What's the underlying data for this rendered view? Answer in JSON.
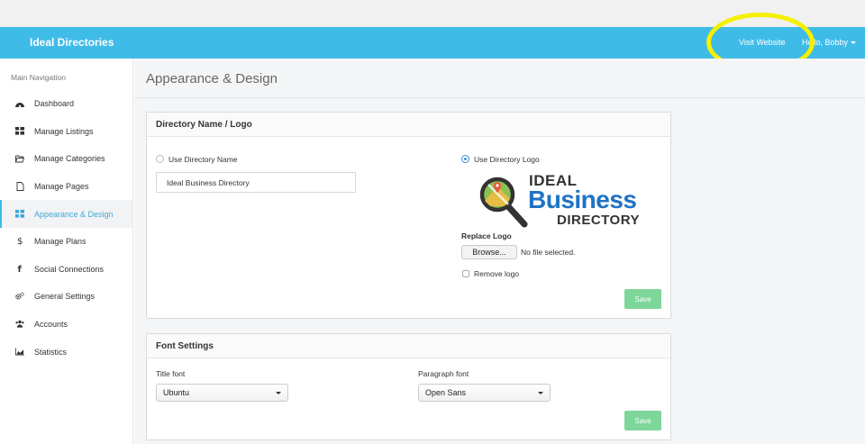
{
  "navbar": {
    "brand": "Ideal Directories",
    "visit_website": "Visit Website",
    "user_greeting": "Hello, Bobby"
  },
  "sidebar": {
    "heading": "Main Navigation",
    "items": [
      {
        "label": "Dashboard",
        "icon": "dashboard-icon"
      },
      {
        "label": "Manage Listings",
        "icon": "th-large-icon"
      },
      {
        "label": "Manage Categories",
        "icon": "folder-open-icon"
      },
      {
        "label": "Manage Pages",
        "icon": "file-icon"
      },
      {
        "label": "Appearance & Design",
        "icon": "grid-icon",
        "active": true
      },
      {
        "label": "Manage Plans",
        "icon": "dollar-icon"
      },
      {
        "label": "Social Connections",
        "icon": "facebook-icon"
      },
      {
        "label": "General Settings",
        "icon": "gears-icon"
      },
      {
        "label": "Accounts",
        "icon": "users-icon"
      },
      {
        "label": "Statistics",
        "icon": "area-chart-icon"
      }
    ]
  },
  "page": {
    "title": "Appearance & Design"
  },
  "directory_panel": {
    "heading": "Directory Name / Logo",
    "use_name_label": "Use Directory Name",
    "name_value": "Ideal Business Directory",
    "use_logo_label": "Use Directory Logo",
    "logo_text": {
      "line1": "IDEAL",
      "line2": "Business",
      "line3": "DIRECTORY"
    },
    "replace_logo_label": "Replace Logo",
    "browse_button": "Browse...",
    "no_file_text": "No file selected.",
    "remove_logo_label": "Remove logo",
    "save_label": "Save",
    "selected_option": "Use Directory Logo"
  },
  "font_panel": {
    "heading": "Font Settings",
    "title_font_label": "Title font",
    "title_font_value": "Ubuntu",
    "paragraph_font_label": "Paragraph font",
    "paragraph_font_value": "Open Sans",
    "save_label": "Save"
  },
  "colors": {
    "navbar": "#3fbbe8",
    "accent": "#3fa9d6",
    "logo_blue": "#1f73c2",
    "save_button": "#7dd69a",
    "annotation_ring": "#f5ef00"
  }
}
